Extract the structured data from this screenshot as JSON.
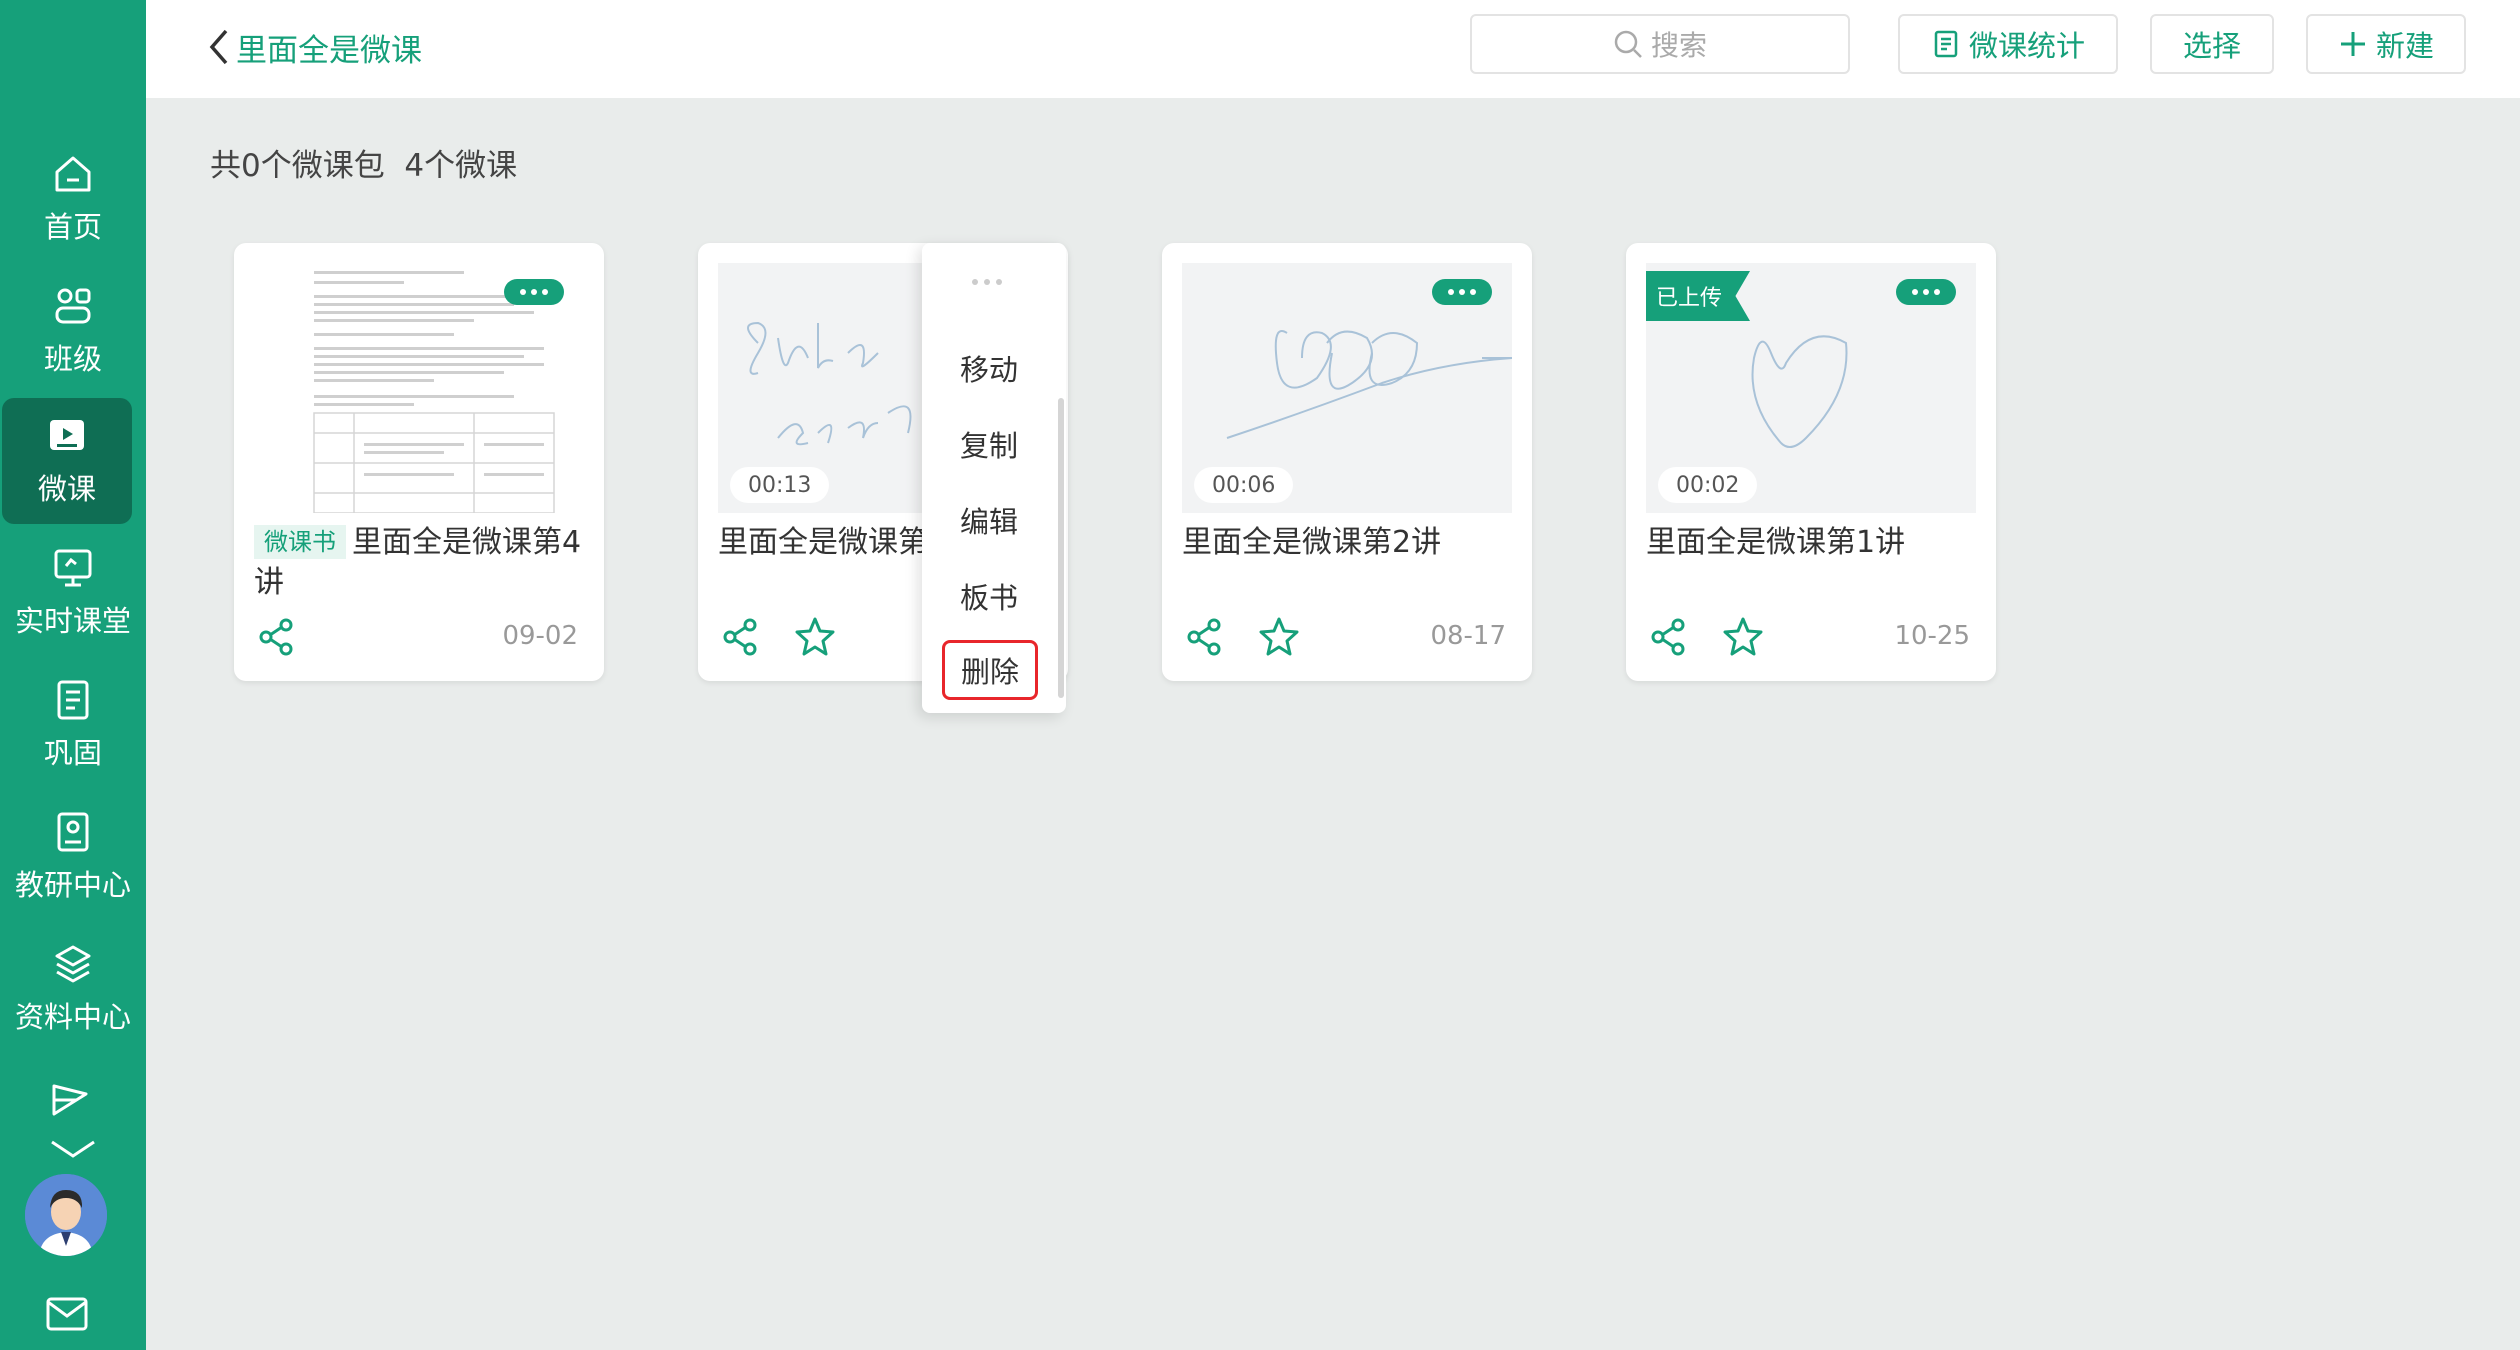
{
  "sidebar": {
    "items": [
      {
        "label": "首页",
        "icon": "home-icon"
      },
      {
        "label": "班级",
        "icon": "class-icon"
      },
      {
        "label": "微课",
        "icon": "micro-lesson-icon",
        "active": true
      },
      {
        "label": "实时课堂",
        "icon": "live-class-icon"
      },
      {
        "label": "巩固",
        "icon": "practice-icon"
      },
      {
        "label": "教研中心",
        "icon": "research-icon"
      },
      {
        "label": "资料中心",
        "icon": "resources-icon"
      }
    ]
  },
  "header": {
    "back_label": "里面全是微课",
    "search_placeholder": "搜索",
    "stats_label": "微课统计",
    "select_label": "选择",
    "new_label": "新建"
  },
  "summary": "共0个微课包  4个微课",
  "cards": [
    {
      "tag": "微课书",
      "title": "里面全是微课第4讲",
      "date": "09-02"
    },
    {
      "duration": "00:13",
      "title": "里面全是微课第",
      "date": ""
    },
    {
      "duration": "00:06",
      "title": "里面全是微课第2讲",
      "date": "08-17"
    },
    {
      "badge": "已上传",
      "duration": "00:02",
      "title": "里面全是微课第1讲",
      "date": "10-25"
    }
  ],
  "context_menu": {
    "items": [
      "移动",
      "复制",
      "编辑",
      "板书",
      "删除"
    ],
    "highlighted": "删除"
  },
  "colors": {
    "brand": "#16a07a",
    "brand_dark": "#0f6e54",
    "danger": "#e8262b",
    "background": "#e9eceb"
  }
}
